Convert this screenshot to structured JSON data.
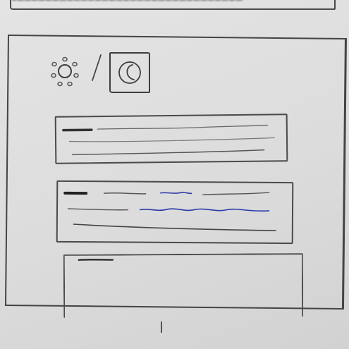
{
  "app": {
    "screen": "wireframe-sketch"
  },
  "theme_toggle": {
    "light_icon": "sun-icon",
    "dark_icon": "moon-icon",
    "selected": "dark"
  },
  "cards": [
    {
      "id": "card-1",
      "lines": [
        "title-scribble",
        "text-scribble",
        "text-scribble"
      ]
    },
    {
      "id": "card-2",
      "lines": [
        "title-scribble",
        "text-scribble",
        "link-scribble",
        "text-scribble"
      ],
      "accent": "#2a3aa8"
    },
    {
      "id": "card-3",
      "lines": [
        "title-scribble"
      ]
    }
  ],
  "colors": {
    "pencil": "#4a4a4a",
    "paper": "#dedede",
    "link_accent": "#2a3aa8"
  }
}
